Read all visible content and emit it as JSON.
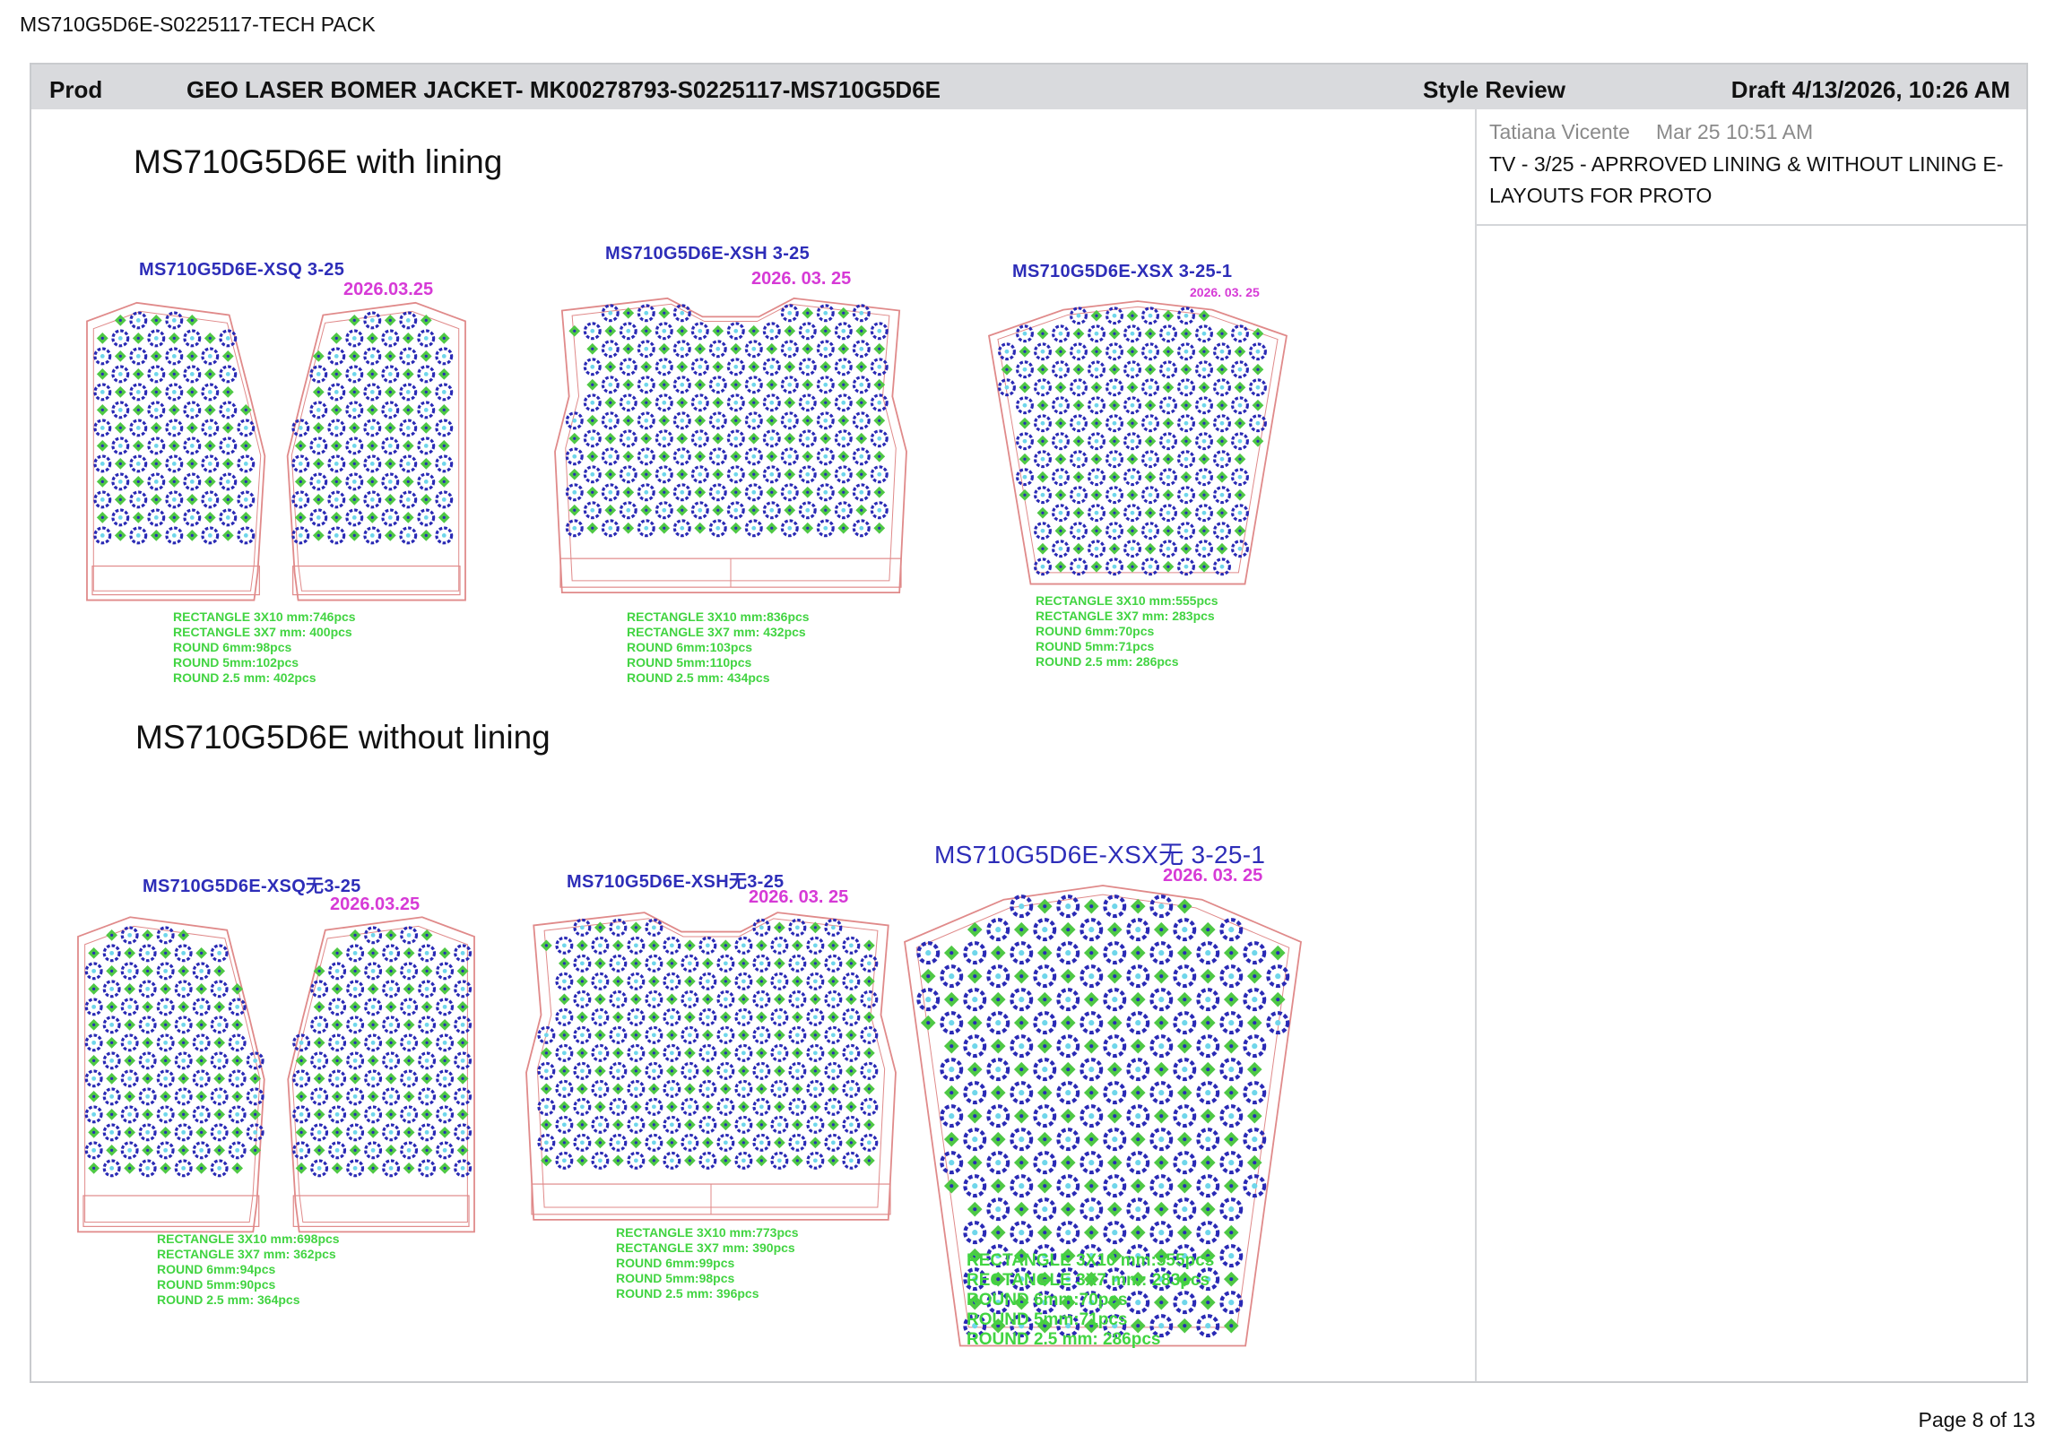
{
  "doc_title": "MS710G5D6E-S0225117-TECH PACK",
  "header": {
    "prod": "Prod",
    "title": "GEO LASER BOMER JACKET- MK00278793-S0225117-MS710G5D6E",
    "review": "Style Review",
    "draft": "Draft 4/13/2026, 10:26 AM"
  },
  "comment": {
    "author": "Tatiana Vicente",
    "time": "Mar 25 10:51 AM",
    "body": "TV - 3/25 - APRROVED LINING & WITHOUT LINING E-LAYOUTS FOR PROTO"
  },
  "sections": {
    "with_lining": {
      "title": "MS710G5D6E with lining",
      "pieces": [
        {
          "code": "MS710G5D6E-XSQ 3-25",
          "date": "2026.03.25",
          "specs": [
            "RECTANGLE 3X10 mm:746pcs",
            "RECTANGLE 3X7 mm: 400pcs",
            "ROUND 6mm:98pcs",
            "ROUND 5mm:102pcs",
            "ROUND 2.5 mm: 402pcs"
          ]
        },
        {
          "code": "MS710G5D6E-XSH 3-25",
          "date": "2026. 03. 25",
          "specs": [
            "RECTANGLE 3X10 mm:836pcs",
            "RECTANGLE 3X7 mm: 432pcs",
            "ROUND 6mm:103pcs",
            "ROUND 5mm:110pcs",
            "ROUND 2.5 mm: 434pcs"
          ]
        },
        {
          "code": "MS710G5D6E-XSX 3-25-1",
          "date": "2026. 03. 25",
          "specs": [
            "RECTANGLE 3X10 mm:555pcs",
            "RECTANGLE 3X7 mm: 283pcs",
            "ROUND 6mm:70pcs",
            "ROUND 5mm:71pcs",
            "ROUND 2.5 mm: 286pcs"
          ]
        }
      ]
    },
    "without_lining": {
      "title": "MS710G5D6E without lining",
      "pieces": [
        {
          "code": "MS710G5D6E-XSQ无3-25",
          "date": "2026.03.25",
          "specs": [
            "RECTANGLE 3X10 mm:698pcs",
            "RECTANGLE 3X7 mm: 362pcs",
            "ROUND 6mm:94pcs",
            "ROUND 5mm:90pcs",
            "ROUND 2.5 mm: 364pcs"
          ]
        },
        {
          "code": "MS710G5D6E-XSH无3-25",
          "date": "2026. 03. 25",
          "specs": [
            "RECTANGLE 3X10 mm:773pcs",
            "RECTANGLE 3X7 mm: 390pcs",
            "ROUND 6mm:99pcs",
            "ROUND 5mm:98pcs",
            "ROUND 2.5 mm: 396pcs"
          ]
        },
        {
          "code": "MS710G5D6E-XSX无 3-25-1",
          "date": "2026. 03. 25",
          "specs": [
            "RECTANGLE 3X10 mm:555pcs",
            "RECTANGLE 3X7 mm: 283pcs",
            "ROUND 6mm:70pcs",
            "ROUND 5mm:71pcs",
            "ROUND 2.5 mm: 286pcs"
          ]
        }
      ]
    }
  },
  "page_label": "Page 8 of 13",
  "colors": {
    "outline": "#e08a8a",
    "motif_blue": "#2a2ab5",
    "motif_green": "#4fc845",
    "motif_cyan": "#6fd6ea",
    "code_text": "#2d2db8",
    "date_text": "#d63ad6",
    "spec_text": "#42d442"
  }
}
